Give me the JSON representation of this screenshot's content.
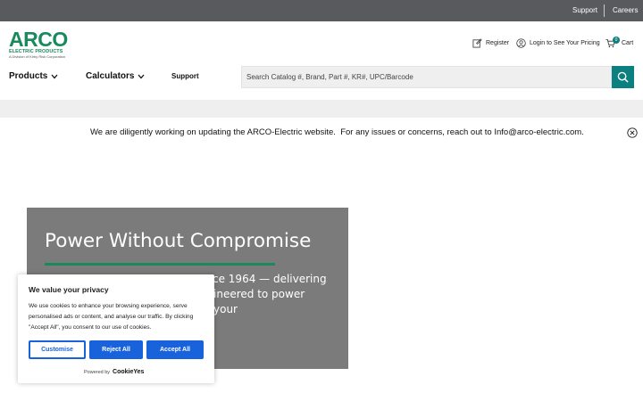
{
  "topbar": {
    "support": "Support",
    "careers": "Careers"
  },
  "logo": {
    "brand": "ARCO",
    "line1": "ELECTRIC PRODUCTS",
    "line2": "A Division of Kirby Risk Corporation"
  },
  "header": {
    "register": "Register",
    "login": "Login to See Your Pricing",
    "cart_count": "0",
    "cart": "Cart"
  },
  "nav": {
    "products": "Products",
    "calculators": "Calculators",
    "support": "Support"
  },
  "search": {
    "placeholder": "Search Catalog #, Brand, Part #, KR#, UPC/Barcode"
  },
  "notice": {
    "text": "We are diligently working on updating the ARCO-Electric website.  For any issues or concerns, reach out to Info@arco-electric.com."
  },
  "hero": {
    "title": "Power Without Compromise",
    "body_visible_1": "ce 1964 — delivering",
    "body_visible_2": "ineered to power your"
  },
  "cookie": {
    "title": "We value your privacy",
    "body": "We use cookies to enhance your browsing experience, serve personalised ads or content, and analyse our traffic. By clicking \"Accept All\", you consent to our use of cookies.",
    "customise": "Customise",
    "reject": "Reject All",
    "accept": "Accept All",
    "powered_by": "Powered by",
    "powered_brand": "CookieYes"
  },
  "colors": {
    "brand_green": "#198a5c",
    "teal": "#0c7f80",
    "cookie_blue": "#1863dc"
  }
}
